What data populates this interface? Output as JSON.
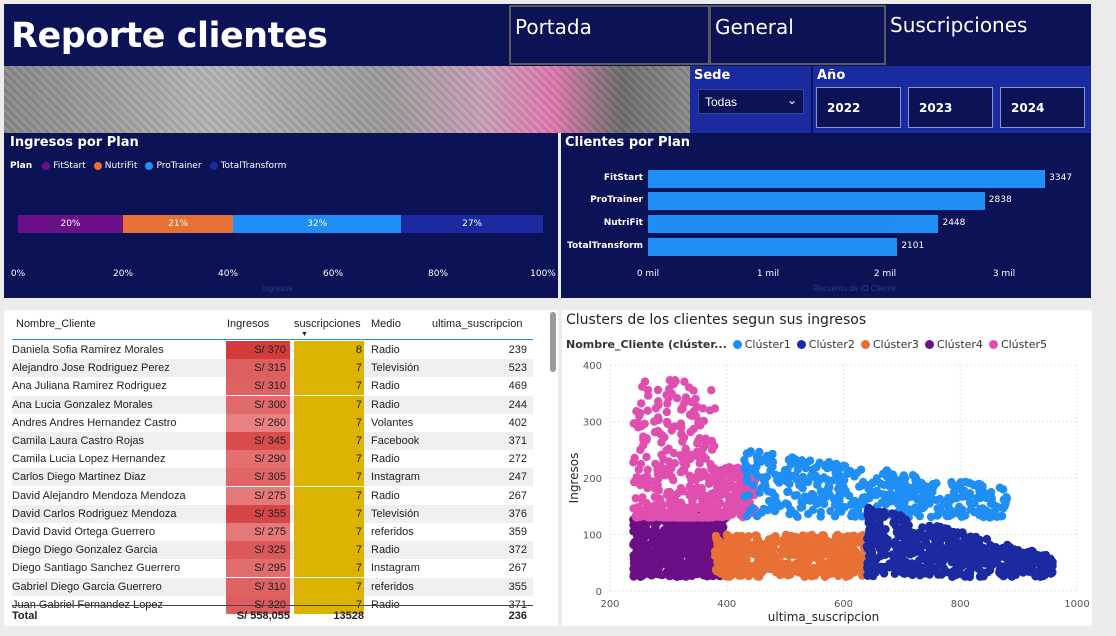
{
  "header": {
    "title": "Reporte clientes",
    "nav": [
      "Portada",
      "General",
      "Suscripciones"
    ]
  },
  "filters": {
    "sede_label": "Sede",
    "sede_value": "Todas",
    "anio_label": "Año",
    "years": [
      "2022",
      "2023",
      "2024"
    ]
  },
  "ingresos_por_plan": {
    "title": "Ingresos por Plan",
    "legend_title": "Plan",
    "axis_title": "Ingresos",
    "ticks": [
      "0%",
      "20%",
      "40%",
      "60%",
      "80%",
      "100%"
    ],
    "chart_data": {
      "type": "bar",
      "stacked": "100%",
      "series": [
        {
          "name": "FitStart",
          "value": 20,
          "label": "20%",
          "color": "#6b0f86"
        },
        {
          "name": "NutriFit",
          "value": 21,
          "label": "21%",
          "color": "#e87035"
        },
        {
          "name": "ProTrainer",
          "value": 32,
          "label": "32%",
          "color": "#1f8ef5"
        },
        {
          "name": "TotalTransform",
          "value": 27,
          "label": "27%",
          "color": "#1b2aa0"
        }
      ]
    }
  },
  "clientes_por_plan": {
    "title": "Clientes por Plan",
    "axis_title": "Recuento de ID Cliente",
    "ticks": [
      "0 mil",
      "1 mil",
      "2 mil",
      "3 mil"
    ],
    "chart_data": {
      "type": "bar",
      "orientation": "horizontal",
      "categories": [
        "FitStart",
        "ProTrainer",
        "NutriFit",
        "TotalTransform"
      ],
      "values": [
        3347,
        2838,
        2448,
        2101
      ],
      "xlim": [
        0,
        3500
      ],
      "color": "#1f8ef5"
    }
  },
  "table": {
    "columns": [
      "Nombre_Cliente",
      "Ingresos",
      "suscripciones",
      "Medio",
      "ultima_suscripcion"
    ],
    "rows": [
      [
        "Daniela Sofia Ramirez Morales",
        "S/ 370",
        "8",
        "Radio",
        "239"
      ],
      [
        "Alejandro Jose Rodriguez Perez",
        "S/ 315",
        "7",
        "Televisión",
        "523"
      ],
      [
        "Ana Juliana Ramirez Rodriguez",
        "S/ 310",
        "7",
        "Radio",
        "469"
      ],
      [
        "Ana Lucia Gonzalez Morales",
        "S/ 300",
        "7",
        "Radio",
        "244"
      ],
      [
        "Andres Andres Hernandez Castro",
        "S/ 260",
        "7",
        "Volantes",
        "402"
      ],
      [
        "Camila Laura Castro Rojas",
        "S/ 345",
        "7",
        "Facebook",
        "371"
      ],
      [
        "Camila Lucia Lopez Hernandez",
        "S/ 290",
        "7",
        "Radio",
        "272"
      ],
      [
        "Carlos Diego Martinez Diaz",
        "S/ 305",
        "7",
        "Instagram",
        "247"
      ],
      [
        "David Alejandro Mendoza Mendoza",
        "S/ 275",
        "7",
        "Radio",
        "267"
      ],
      [
        "David Carlos Rodriguez Mendoza",
        "S/ 355",
        "7",
        "Televisión",
        "376"
      ],
      [
        "David David Ortega Guerrero",
        "S/ 275",
        "7",
        "referidos",
        "359"
      ],
      [
        "Diego Diego Gonzalez Garcia",
        "S/ 325",
        "7",
        "Radio",
        "372"
      ],
      [
        "Diego Santiago Sanchez Guerrero",
        "S/ 295",
        "7",
        "Instagram",
        "267"
      ],
      [
        "Gabriel Diego Garcia Guerrero",
        "S/ 310",
        "7",
        "referidos",
        "355"
      ],
      [
        "Juan Gabriel Fernandez Lopez",
        "S/ 320",
        "7",
        "Radio",
        "371"
      ]
    ],
    "total": [
      "Total",
      "S/ 558,055",
      "13528",
      "",
      "236"
    ]
  },
  "scatter": {
    "title": "Clusters de los clientes segun sus ingresos",
    "legend_title": "Nombre_Cliente (clúster...",
    "xlabel": "ultima_suscripcion",
    "ylabel": "Ingresos",
    "xticks": [
      "200",
      "400",
      "600",
      "800",
      "1000"
    ],
    "yticks": [
      "0",
      "100",
      "200",
      "300",
      "400"
    ],
    "chart_data": {
      "type": "scatter",
      "xlim": [
        200,
        1000
      ],
      "ylim": [
        0,
        400
      ],
      "series": [
        {
          "name": "Clúster1",
          "color": "#1f8ef5",
          "x_range": [
            430,
            880
          ],
          "y_range": [
            130,
            250
          ]
        },
        {
          "name": "Clúster2",
          "color": "#1b2aa0",
          "x_range": [
            640,
            960
          ],
          "y_range": [
            25,
            150
          ]
        },
        {
          "name": "Clúster3",
          "color": "#e87035",
          "x_range": [
            380,
            640
          ],
          "y_range": [
            25,
            100
          ]
        },
        {
          "name": "Clúster4",
          "color": "#6b0f86",
          "x_range": [
            240,
            400
          ],
          "y_range": [
            25,
            135
          ]
        },
        {
          "name": "Clúster5",
          "color": "#e04fb0",
          "x_range": [
            240,
            450
          ],
          "y_range": [
            130,
            375
          ]
        }
      ]
    }
  }
}
